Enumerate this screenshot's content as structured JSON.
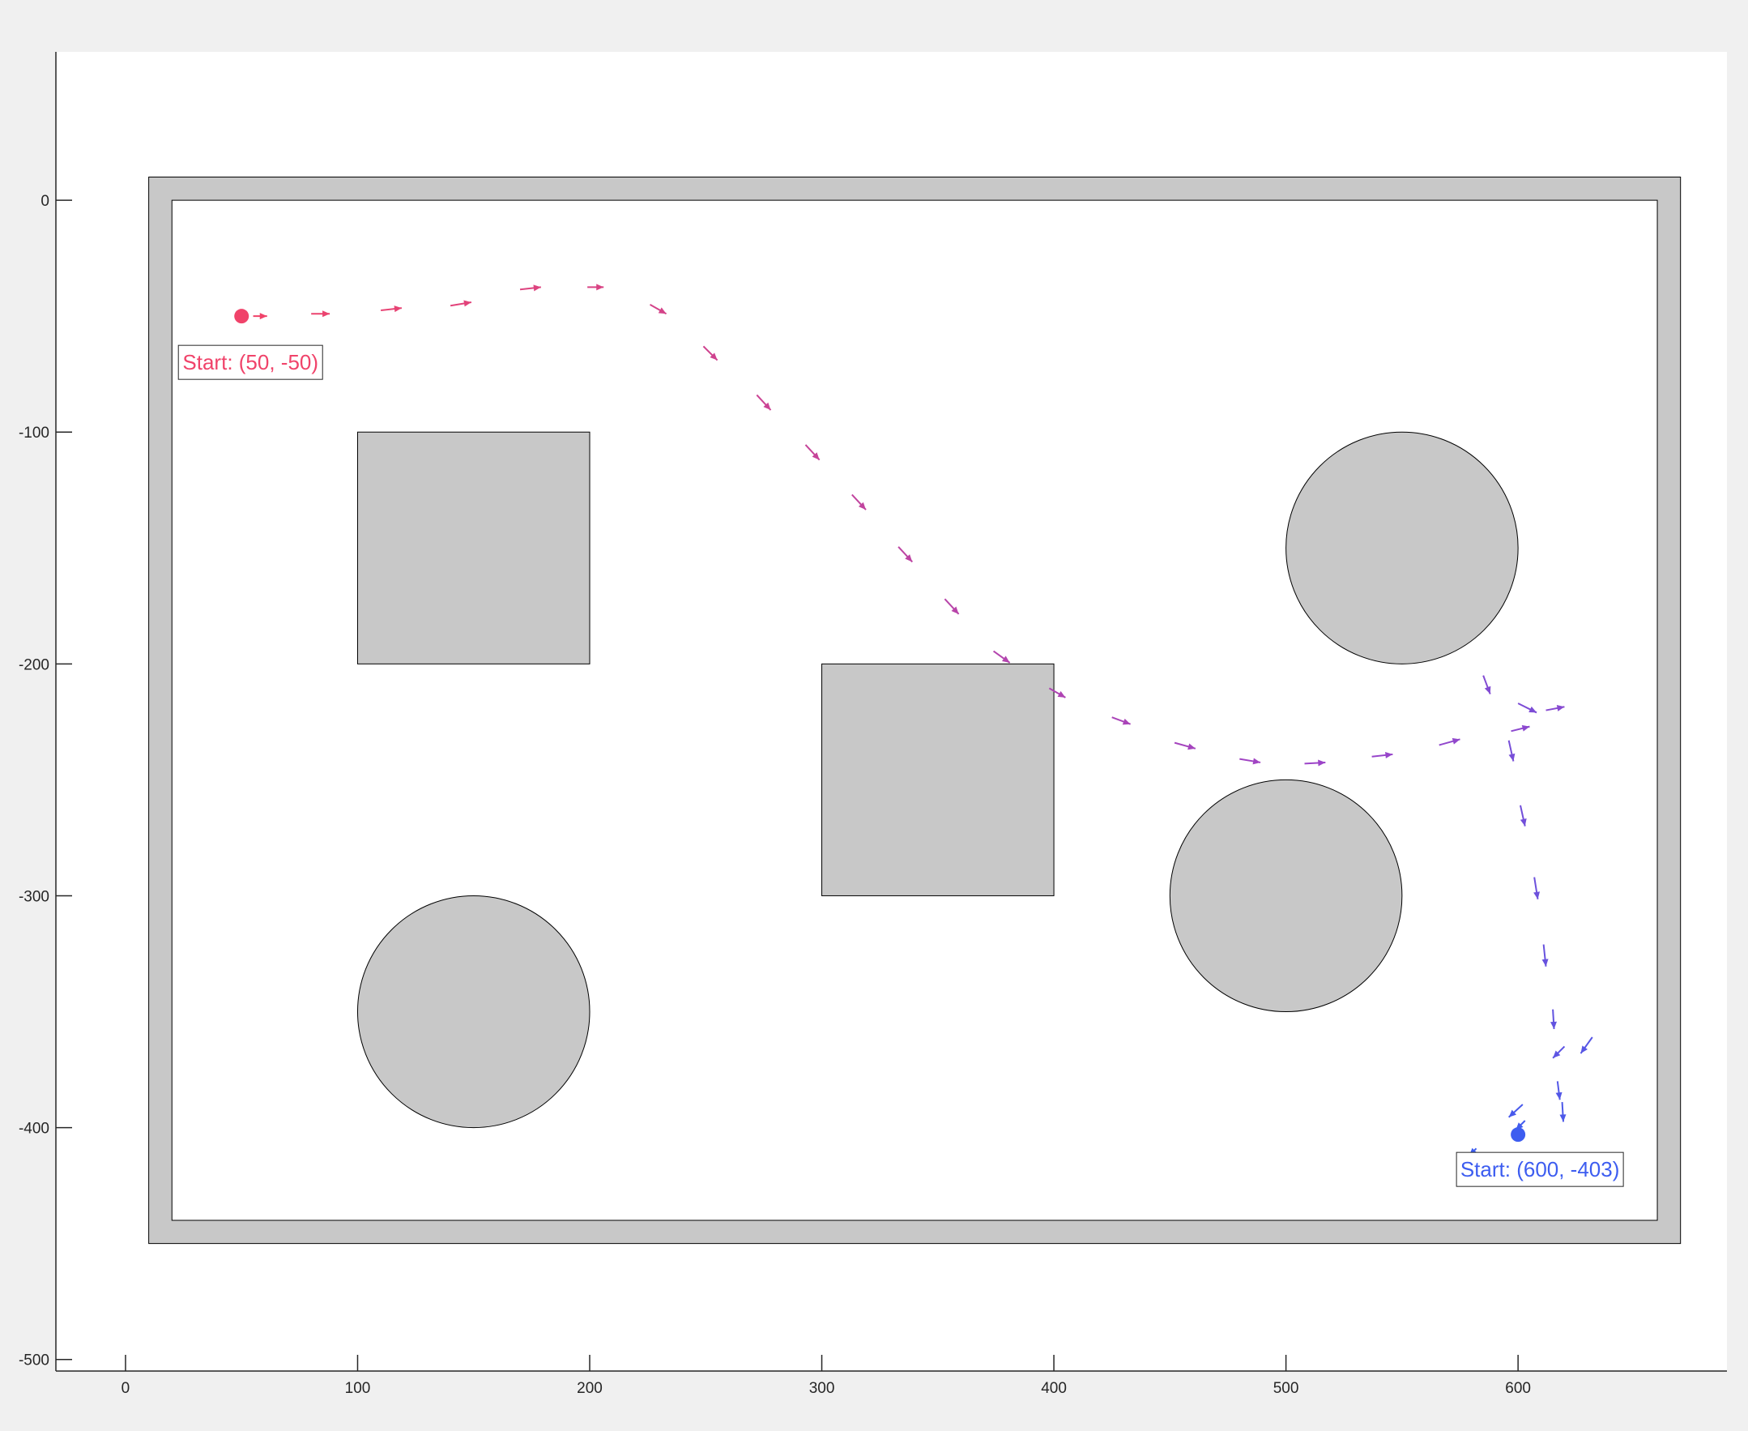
{
  "chart_data": {
    "type": "scatter",
    "title": "",
    "xlabel": "",
    "ylabel": "",
    "xlim": [
      -30,
      690
    ],
    "ylim": [
      -505,
      64
    ],
    "xticks": [
      0,
      100,
      200,
      300,
      400,
      500,
      600
    ],
    "yticks": [
      -500,
      -400,
      -300,
      -200,
      -100,
      0
    ],
    "xtick_labels": [
      "0",
      "100",
      "200",
      "300",
      "400",
      "500",
      "600"
    ],
    "ytick_labels": [
      "-500",
      "-400",
      "-300",
      "-200",
      "-100",
      "0"
    ],
    "grid": false,
    "colors": {
      "obstacle_fill": "#c8c8c8",
      "edge": "#000000",
      "start_red": "#f0436a",
      "start_blue": "#3d5df0",
      "path_mid": "#9c44c8"
    },
    "walls": {
      "outer": [
        10,
        -450,
        670,
        10
      ],
      "inner": [
        20,
        -440,
        660,
        0
      ]
    },
    "obstacles": [
      {
        "shape": "rect",
        "x0": 100,
        "y0": -200,
        "x1": 200,
        "y1": -100
      },
      {
        "shape": "rect",
        "x0": 300,
        "y0": -300,
        "x1": 400,
        "y1": -200
      },
      {
        "shape": "circle",
        "cx": 150,
        "cy": -350,
        "r": 50
      },
      {
        "shape": "circle",
        "cx": 550,
        "cy": -150,
        "r": 50
      },
      {
        "shape": "circle",
        "cx": 500,
        "cy": -300,
        "r": 50
      }
    ],
    "starts": [
      {
        "name": "Start: (50, -50)",
        "x": 50,
        "y": -50,
        "color": "#f0436a",
        "label": "Start: (50, -50)"
      },
      {
        "name": "Start: (600, -403)",
        "x": 600,
        "y": -403,
        "color": "#3d5df0",
        "label": "Start: (600, -403)"
      }
    ],
    "series": [
      {
        "type": "quiver",
        "vectors": [
          [
            55,
            -50,
            6,
            0
          ],
          [
            80,
            -49,
            8,
            0
          ],
          [
            110,
            -47.5,
            9,
            1
          ],
          [
            140,
            -45.5,
            9,
            1.5
          ],
          [
            170,
            -38.5,
            9,
            1
          ],
          [
            199,
            -37.5,
            7,
            0
          ],
          [
            226,
            -45,
            7,
            -4
          ],
          [
            249,
            -63,
            6,
            -6
          ],
          [
            272,
            -84,
            6,
            -6.5
          ],
          [
            293,
            -105.5,
            6,
            -6.5
          ],
          [
            313,
            -127,
            6,
            -6.5
          ],
          [
            333,
            -149.5,
            6,
            -6.5
          ],
          [
            353,
            -172,
            6,
            -6.5
          ],
          [
            374,
            -194.5,
            7,
            -5
          ],
          [
            398,
            -210.5,
            7,
            -4
          ],
          [
            425,
            -223,
            8,
            -3
          ],
          [
            452,
            -234,
            9,
            -2.5
          ],
          [
            480,
            -241,
            9,
            -1.5
          ],
          [
            508,
            -243,
            9,
            0.5
          ],
          [
            537,
            -240,
            9,
            1
          ],
          [
            566,
            -235,
            9,
            2.5
          ],
          [
            597,
            -229,
            8,
            2
          ],
          [
            612,
            -220,
            8,
            1.5
          ],
          [
            585,
            -205,
            3,
            -8
          ],
          [
            600,
            -217,
            8,
            -4
          ],
          [
            596,
            -233,
            2,
            -9
          ],
          [
            601,
            -261,
            2,
            -9
          ],
          [
            607,
            -292,
            1.5,
            -9.5
          ],
          [
            611,
            -321,
            1,
            -9.5
          ],
          [
            615,
            -349,
            0.5,
            -8.5
          ],
          [
            620,
            -365,
            -5,
            -5
          ],
          [
            632,
            -361,
            -5,
            -7
          ],
          [
            617,
            -380,
            1,
            -8
          ],
          [
            619,
            -389,
            0.5,
            -8.5
          ],
          [
            602,
            -390,
            -6,
            -5.5
          ],
          [
            603,
            -397,
            -4,
            -4
          ],
          [
            582,
            -409,
            -3,
            -3
          ]
        ]
      }
    ]
  }
}
